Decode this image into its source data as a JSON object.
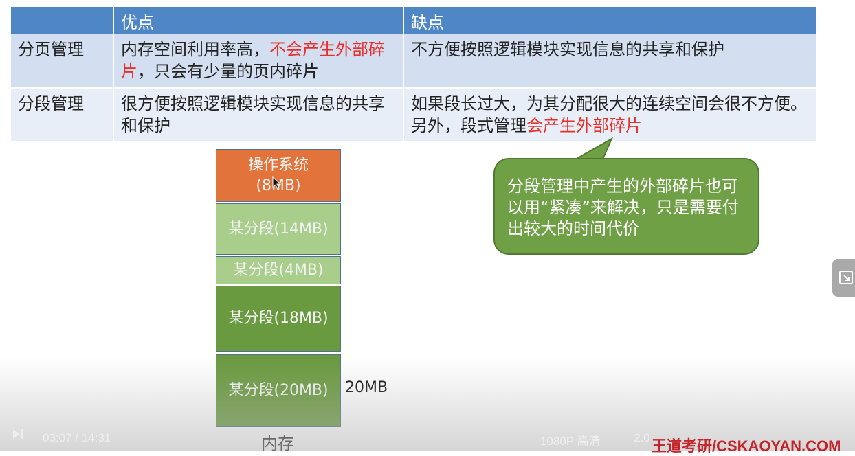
{
  "table": {
    "headers": [
      "",
      "优点",
      "缺点"
    ],
    "rows": [
      {
        "name": "分页管理",
        "pros_a": "内存空间利用率高，",
        "pros_red": "不会产生外部碎片",
        "pros_b": "，只会有少量的页内碎片",
        "cons_a": "不方便按照逻辑模块实现信息的共享和保护",
        "cons_red": "",
        "cons_b": ""
      },
      {
        "name": "分段管理",
        "pros_a": "很方便按照逻辑模块实现信息的共享和保护",
        "pros_red": "",
        "pros_b": "",
        "cons_a": "如果段长过大，为其分配很大的连续空间会很不方便。另外，段式管理",
        "cons_red": "会产生外部碎片",
        "cons_b": ""
      }
    ]
  },
  "memory": {
    "blocks": [
      {
        "label": "操作系统",
        "size": "(8MB)"
      },
      {
        "label": "某分段(14MB)"
      },
      {
        "label": "某分段(4MB)"
      },
      {
        "label": "某分段(18MB)"
      },
      {
        "label": "某分段(20MB)"
      }
    ],
    "caption": "内存",
    "side_label": "20MB"
  },
  "bubble": {
    "text": "分段管理中产生的外部碎片也可以用“紧凑”来解决，只是需要付出较大的时间代价"
  },
  "player": {
    "time": "03:07 / 14:31",
    "quality": "1080P 高清",
    "speed": "2.0",
    "watermark": "王道考研/CSKAOYAN.COM"
  },
  "colors": {
    "header_blue": "#4f86c6",
    "os_orange": "#e2733a",
    "segment_light": "#a9cd8b",
    "segment_dark": "#6a9a3f",
    "highlight_red": "#e8302b"
  },
  "icons": [
    "play-icon",
    "cursor-icon",
    "side-panel-icon"
  ]
}
